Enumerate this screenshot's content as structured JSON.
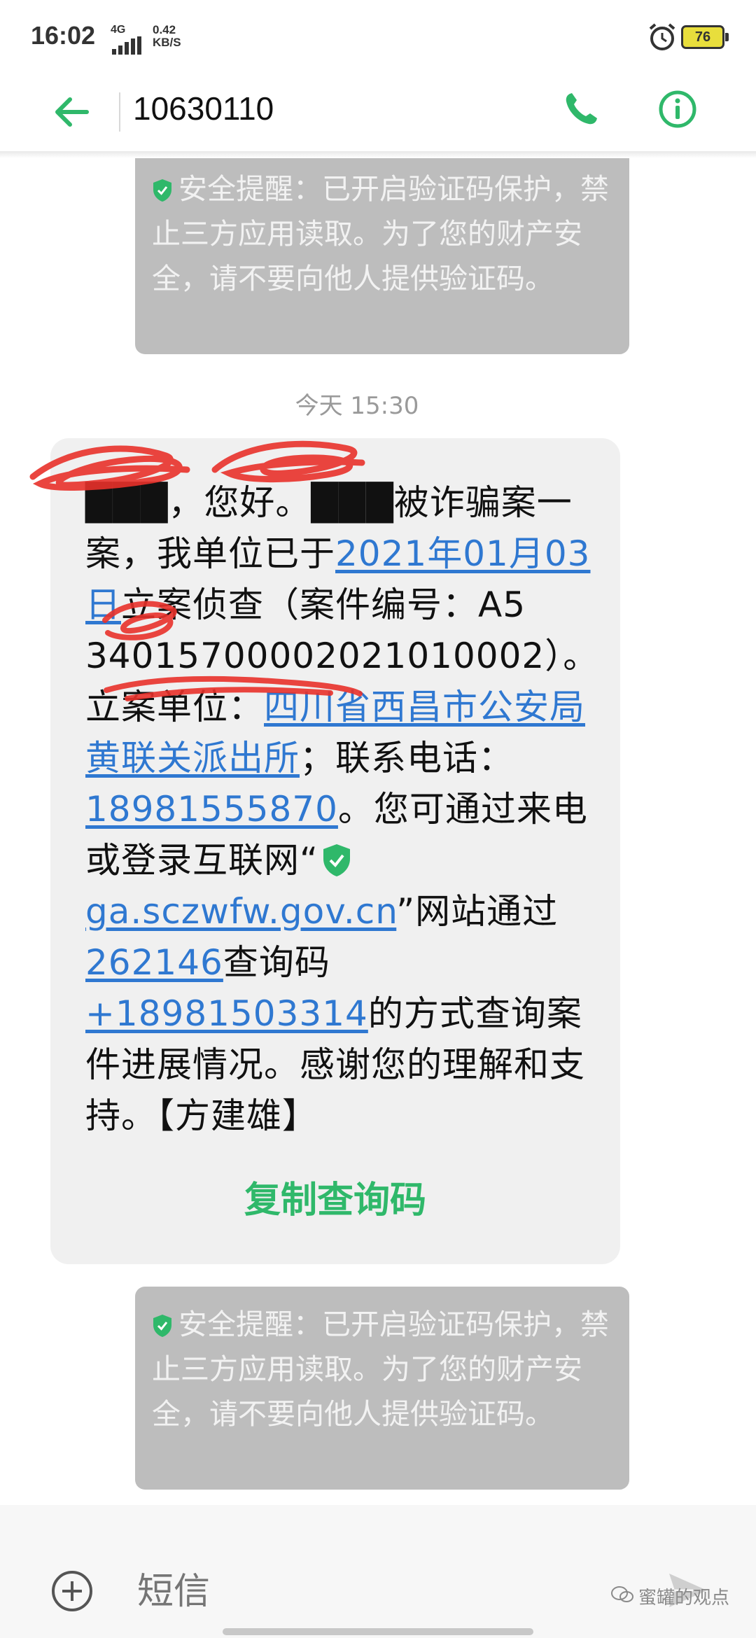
{
  "status_bar": {
    "time": "16:02",
    "network": "4G",
    "speed_value": "0.42",
    "speed_unit": "KB/S",
    "battery": "76",
    "battery_color": "#e8de3c"
  },
  "header": {
    "contact": "10630110",
    "back_icon": "arrow-left-icon",
    "call_icon": "phone-icon",
    "info_icon": "info-icon",
    "accent_color": "#2fb86a"
  },
  "security_notice": {
    "text": "安全提醒：已开启验证码保护，禁止三方应用读取。为了您的财产安全，请不要向他人提供验证码。"
  },
  "timestamp": "今天 15:30",
  "message": {
    "p1": "，您好。",
    "p2": "被诈骗案一案，我单位已于",
    "date_link": "2021年01月03日",
    "p3": "立案侦查（案件编号：",
    "case_no_visible": "34015700002021010002",
    "p4": "）。立案单位：",
    "unit_link": "四川省西昌市公安局黄联关派出所",
    "p5": "；联系电话：",
    "phone_link": "18981555870",
    "p6": "。您可通过来电或登录互联网“",
    "site_link": "ga.sczwfw.gov.cn",
    "p7": "”网站通过",
    "query_code_link": "262146",
    "p8": "查询码",
    "query_phone_link": "+18981503314",
    "p9": "的方式查询案件进展情况。感谢您的理解和支持。【方建雄】",
    "copy_button": "复制查询码",
    "link_color": "#2f78d1"
  },
  "input_bar": {
    "placeholder": "短信",
    "add_icon": "plus-circle-icon",
    "send_icon": "send-icon"
  },
  "watermark": "蜜罐的观点"
}
